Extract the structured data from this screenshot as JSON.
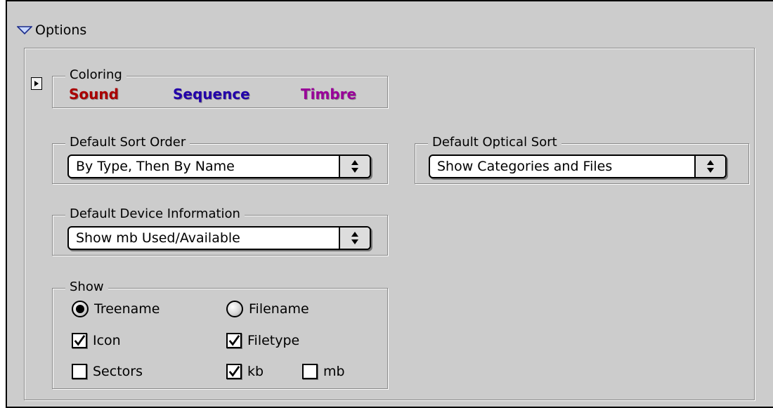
{
  "header": {
    "title": "Options"
  },
  "coloring": {
    "title": "Coloring",
    "labels": [
      {
        "text": "Sound",
        "color": "#aa0000"
      },
      {
        "text": "Sequence",
        "color": "#2200aa"
      },
      {
        "text": "Timbre",
        "color": "#990099"
      }
    ]
  },
  "sort_order": {
    "title": "Default Sort Order",
    "value": "By Type, Then By Name"
  },
  "optical_sort": {
    "title": "Default Optical Sort",
    "value": "Show Categories and Files"
  },
  "device_info": {
    "title": "Default Device Information",
    "value": "Show mb Used/Available"
  },
  "show": {
    "title": "Show",
    "treename": {
      "label": "Treename",
      "selected": true
    },
    "filename": {
      "label": "Filename",
      "selected": false
    },
    "icon": {
      "label": "Icon",
      "checked": true
    },
    "filetype": {
      "label": "Filetype",
      "checked": true
    },
    "sectors": {
      "label": "Sectors",
      "checked": false
    },
    "kb": {
      "label": "kb",
      "checked": true
    },
    "mb": {
      "label": "mb",
      "checked": false
    }
  }
}
